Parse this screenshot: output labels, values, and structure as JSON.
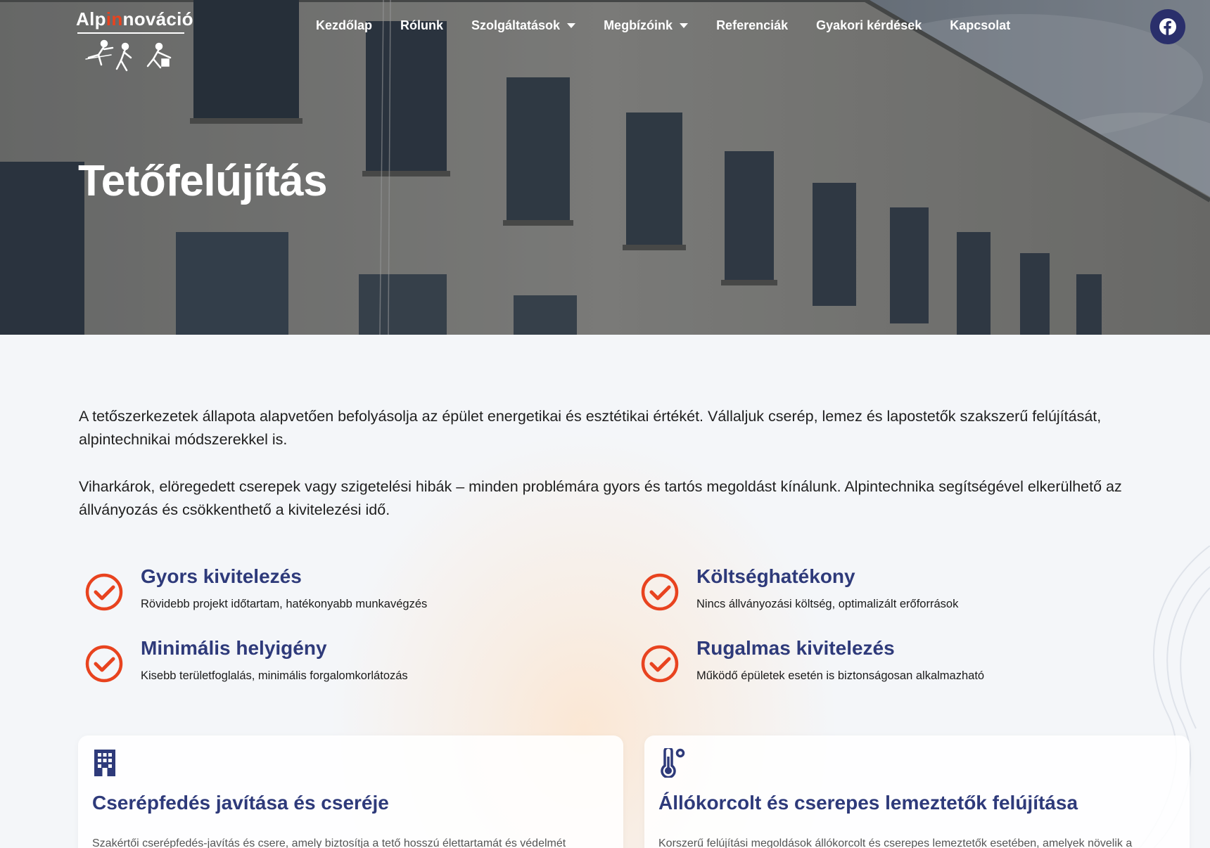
{
  "logo": {
    "text_before": "Alp",
    "text_accent": "in",
    "text_after": "nováció"
  },
  "nav": {
    "items": [
      {
        "label": "Kezdőlap",
        "dropdown": false
      },
      {
        "label": "Rólunk",
        "dropdown": false
      },
      {
        "label": "Szolgáltatások",
        "dropdown": true
      },
      {
        "label": "Megbízóink",
        "dropdown": true
      },
      {
        "label": "Referenciák",
        "dropdown": false
      },
      {
        "label": "Gyakori kérdések",
        "dropdown": false
      },
      {
        "label": "Kapcsolat",
        "dropdown": false
      }
    ],
    "social_icon": "facebook-icon"
  },
  "hero": {
    "title": "Tetőfelújítás"
  },
  "intro": {
    "p1": "A tetőszerkezetek állapota alapvetően befolyásolja az épület energetikai és esztétikai értékét. Vállaljuk cserép, lemez és lapostetők szakszerű felújítását, alpintechnikai módszerekkel is.",
    "p2": "Viharkárok, elöregedett cserepek vagy szigetelési hibák – minden problémára gyors és tartós megoldást kínálunk. Alpintechnika segítségével elkerülhető az állványozás és csökkenthető a kivitelezési idő."
  },
  "features": [
    {
      "title": "Gyors kivitelezés",
      "desc": "Rövidebb projekt időtartam, hatékonyabb munkavégzés",
      "icon": "check-circle-icon"
    },
    {
      "title": "Költséghatékony",
      "desc": "Nincs állványozási költség, optimalizált erőforrások",
      "icon": "check-circle-icon"
    },
    {
      "title": "Minimális helyigény",
      "desc": "Kisebb területfoglalás, minimális forgalomkorlátozás",
      "icon": "check-circle-icon"
    },
    {
      "title": "Rugalmas kivitelezés",
      "desc": "Működő épületek esetén is biztonságosan alkalmazható",
      "icon": "check-circle-icon"
    }
  ],
  "cards": [
    {
      "icon": "building-icon",
      "title": "Cserépfedés javítása és cseréje",
      "desc": "Szakértői cserépfedés-javítás és csere, amely biztosítja a tető hosszú élettartamát és védelmét"
    },
    {
      "icon": "thermometer-icon",
      "title": "Állókorcolt és cserepes lemeztetők felújítása",
      "desc": "Korszerű felújítási megoldások állókorcolt és cserepes lemeztetők esetében, amelyek növelik a"
    }
  ],
  "colors": {
    "accent": "#e8431f",
    "heading": "#2e3a7a",
    "fb_bg": "#2a2f6b"
  }
}
